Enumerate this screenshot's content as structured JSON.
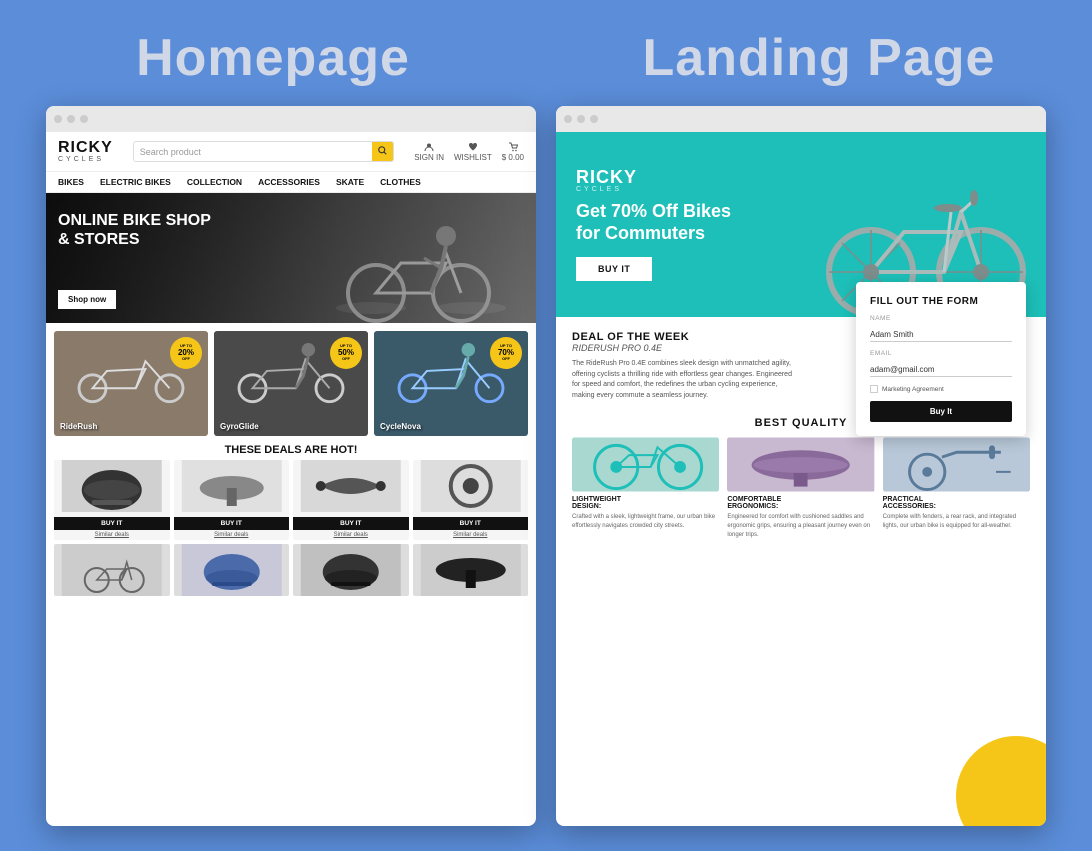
{
  "titles": {
    "homepage": "Homepage",
    "landing": "Landing Page"
  },
  "homepage": {
    "logo": {
      "ricky": "RICKY",
      "cycles": "CYCLES"
    },
    "search": {
      "placeholder": "Search product"
    },
    "icons": {
      "sign_in": "SIGN IN",
      "wishlist": "WISHLIST",
      "cart": "$ 0.00"
    },
    "nav": [
      "BIKES",
      "ELECTRIC BIKES",
      "COLLECTION",
      "ACCESSORIES",
      "SKATE",
      "CLOTHES"
    ],
    "hero": {
      "title": "ONLINE BIKE SHOP\n& STORES",
      "button": "Shop now"
    },
    "product_cards": [
      {
        "name": "RideRush",
        "badge_top": "UP TO",
        "badge_pct": "20%",
        "badge_off": "OFF",
        "bg": "#8a7a6a"
      },
      {
        "name": "GyroGlide",
        "badge_top": "UP TO",
        "badge_pct": "50%",
        "badge_off": "OFF",
        "bg": "#5a5a5a"
      },
      {
        "name": "CycleNova",
        "badge_top": "UP TO",
        "badge_pct": "70%",
        "badge_off": "OFF",
        "bg": "#4a5a6a"
      }
    ],
    "deals_title": "THESE DEALS ARE HOT!",
    "deals": [
      {
        "button": "BUY IT",
        "link": "Similar deals"
      },
      {
        "button": "BUY IT",
        "link": "Similar deals"
      },
      {
        "button": "BUY IT",
        "link": "Similar deals"
      },
      {
        "button": "BUY IT",
        "link": "Similar deals"
      }
    ]
  },
  "landing": {
    "logo": {
      "ricky": "RICKY",
      "cycles": "CYCLES"
    },
    "hero": {
      "heading_line1": "Get 70% Off Bikes",
      "heading_line2": "for Commuters",
      "button": "BUY IT"
    },
    "form": {
      "title": "FILL OUT THE FORM",
      "name_label": "NAME",
      "name_value": "Adam Smith",
      "email_label": "EMAIL",
      "email_value": "adam@gmail.com",
      "checkbox_label": "Marketing Agreement",
      "submit": "Buy It"
    },
    "deal": {
      "title": "DEAL OF THE WEEK",
      "subtitle": "RIDERUSH PRO 0.4E",
      "desc": "The RideRush Pro 0.4E combines sleek design with unmatched agility, offering cyclists a thrilling ride with effortless gear changes. Engineered for speed and comfort, the redefines the urban cycling experience, making every commute a seamless journey."
    },
    "best_quality": {
      "title": "BEST QUALITY",
      "items": [
        {
          "heading": "LIGHTWEIGHT\nDESIGN:",
          "text": "Crafted with a sleek, lightweight frame, our urban bike effortlessly navigates crowded city streets.",
          "bg": "#a8d8d0"
        },
        {
          "heading": "COMFORTABLE\nERGONOMICS:",
          "text": "Engineered for comfort with cushioned saddles and ergonomic grips, ensuring a pleasant journey even on longer trips.",
          "bg": "#c8b8d0"
        },
        {
          "heading": "PRACTICAL\nACCESSORIES:",
          "text": "Complete with fenders, a rear rack, and integrated lights, our urban bike is equipped for all-weather.",
          "bg": "#b8c8d8"
        }
      ]
    }
  }
}
